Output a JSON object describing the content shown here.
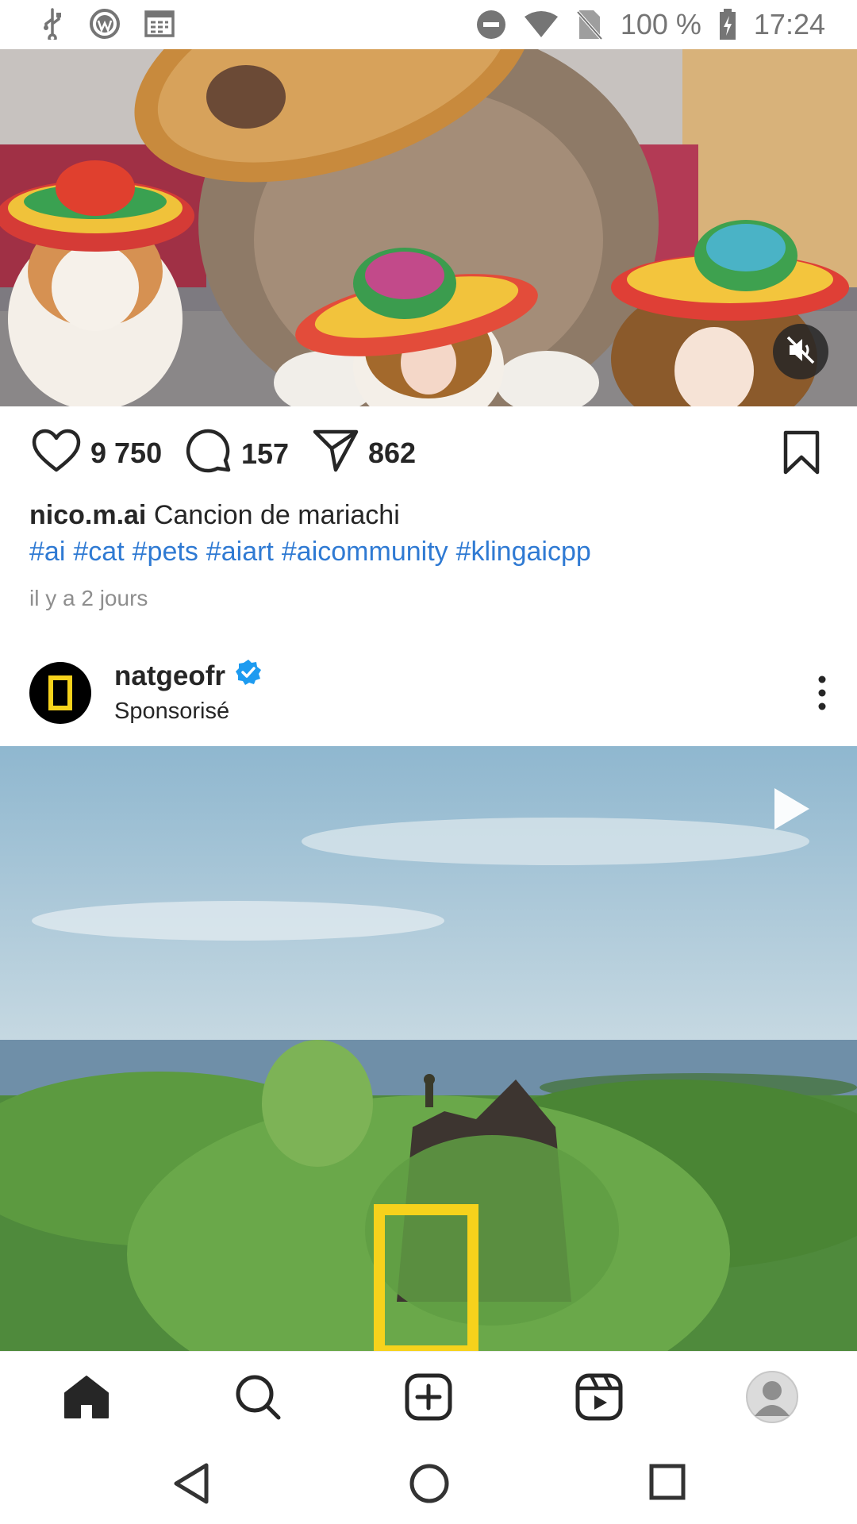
{
  "status_bar": {
    "battery_text": "100 %",
    "time": "17:24",
    "icons": [
      "usb-icon",
      "wordpress-icon",
      "calendar-icon",
      "do-not-disturb-icon",
      "wifi-icon",
      "no-sim-icon",
      "battery-charging-icon"
    ]
  },
  "post1": {
    "likes": "9 750",
    "comments": "157",
    "shares": "862",
    "username": "nico.m.ai",
    "caption_text": "Cancion de mariachi",
    "hashtags": [
      "#ai",
      "#cat",
      "#pets",
      "#aiart",
      "#aicommunity",
      "#klingaicpp"
    ],
    "time_ago": "il y a 2 jours",
    "media_icon": "muted-speaker-icon"
  },
  "post2": {
    "username": "natgeofr",
    "subtitle": "Sponsorisé",
    "verified": true,
    "media_icon": "play-icon"
  },
  "bottom_nav": {
    "items": [
      "home-icon",
      "search-icon",
      "create-icon",
      "reels-icon",
      "profile-icon"
    ]
  },
  "colors": {
    "link_blue": "#2f7ad3",
    "verified_blue": "#1d9bf0",
    "natgeo_yellow": "#f6d21c"
  }
}
